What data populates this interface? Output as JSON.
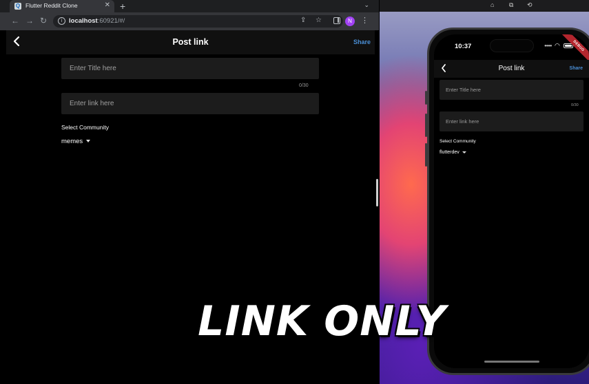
{
  "browser": {
    "tab_title": "Flutter Reddit Clone",
    "tab_favicon": "Q",
    "new_tab_label": "+",
    "url_host": "localhost",
    "url_rest": ":60921/#/",
    "profile_initial": "N"
  },
  "web_app": {
    "title": "Post link",
    "share_label": "Share",
    "title_placeholder": "Enter Title here",
    "title_counter": "0/30",
    "link_placeholder": "Enter link here",
    "select_label": "Select Community",
    "community_value": "memes"
  },
  "phone": {
    "time": "10:37",
    "ribbon_text": "DEBUG",
    "title": "Post link",
    "share_label": "Share",
    "title_placeholder": "Enter Title here",
    "title_counter": "0/30",
    "link_placeholder": "Enter link here",
    "select_label": "Select Community",
    "community_value": "flutterdev"
  },
  "overlay": {
    "caption": "LINK ONLY"
  },
  "colors": {
    "accent_link": "#4a8fd6",
    "app_background": "#000000",
    "field_background": "#1c1c1c",
    "profile_avatar": "#a142f4"
  },
  "icons": [
    "back-arrow-icon",
    "forward-arrow-icon",
    "reload-icon",
    "info-icon",
    "share-page-icon",
    "bookmark-star-icon",
    "side-panel-icon",
    "more-menu-icon",
    "home-icon",
    "screenshot-icon",
    "rotate-icon",
    "wifi-icon",
    "battery-icon"
  ]
}
